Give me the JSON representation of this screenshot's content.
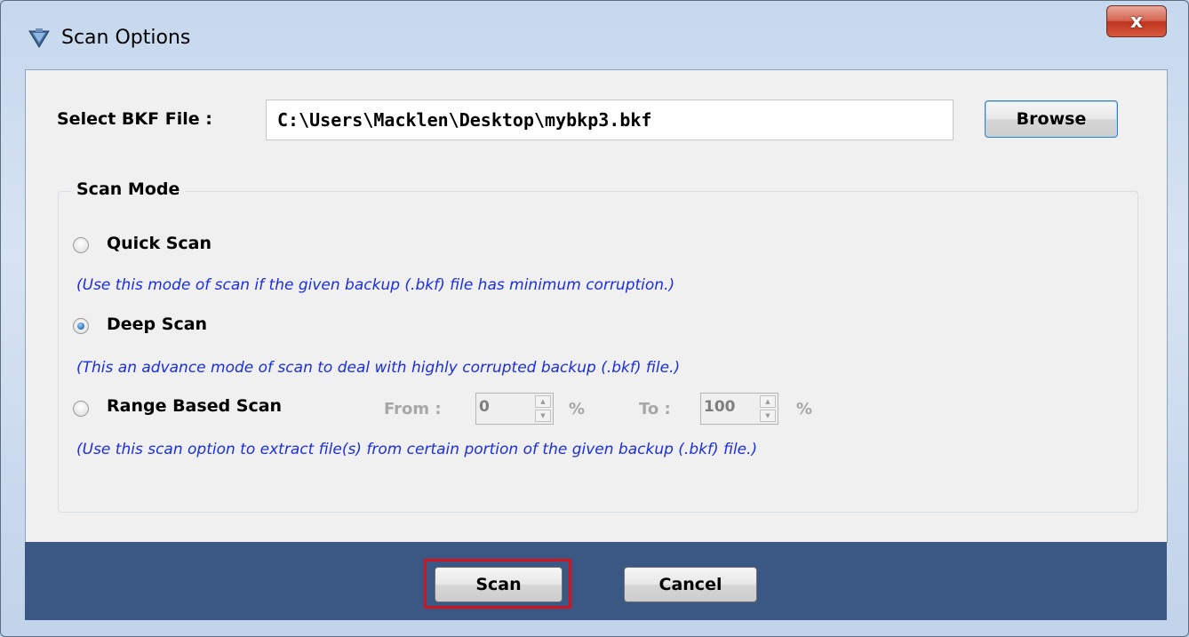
{
  "window": {
    "title": "Scan Options",
    "close_label": "x"
  },
  "file": {
    "label": "Select BKF File :",
    "path": "C:\\Users\\Macklen\\Desktop\\mybkp3.bkf",
    "browse_label": "Browse"
  },
  "scan_mode": {
    "legend": "Scan Mode",
    "selected": "Deep Scan",
    "options": [
      {
        "label": "Quick Scan",
        "checked": false,
        "description": "(Use this mode of scan if the given backup (.bkf) file has minimum corruption.)"
      },
      {
        "label": "Deep Scan",
        "checked": true,
        "description": "(This an advance mode of scan to deal with highly corrupted backup (.bkf) file.)"
      },
      {
        "label": "Range Based Scan",
        "checked": false,
        "description": "(Use this scan option to extract file(s) from certain portion of the given backup (.bkf) file.)"
      }
    ],
    "range": {
      "from_label": "From :",
      "from_value": "0",
      "from_unit": "%",
      "to_label": "To :",
      "to_value": "100",
      "to_unit": "%",
      "enabled": false
    }
  },
  "footer": {
    "scan_label": "Scan",
    "cancel_label": "Cancel"
  },
  "colors": {
    "footer_bg": "#3a5883",
    "description_text": "#1b2ee0",
    "highlight_border": "#d4141c"
  }
}
